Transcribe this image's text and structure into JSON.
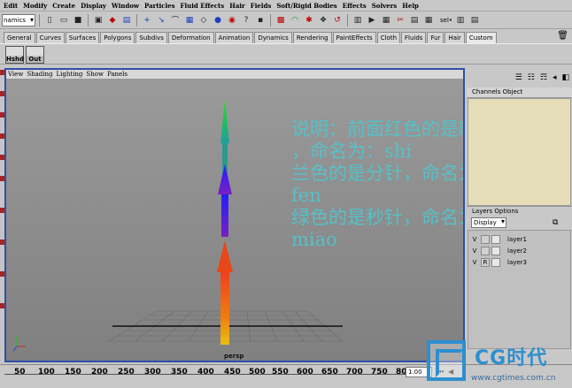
{
  "menu": [
    "Edit",
    "Modify",
    "Create",
    "Display",
    "Window",
    "Particles",
    "Fluid Effects",
    "Hair",
    "Fields",
    "Soft/Rigid Bodies",
    "Effects",
    "Solvers",
    "Help"
  ],
  "status_line": {
    "mode": "namics",
    "sel_field": "sel•"
  },
  "shelf_tabs": [
    "General",
    "Curves",
    "Surfaces",
    "Polygons",
    "Subdivs",
    "Deformation",
    "Animation",
    "Dynamics",
    "Rendering",
    "PaintEffects",
    "Cloth",
    "Fluids",
    "Fur",
    "Hair",
    "Custom"
  ],
  "shelf_buttons": [
    "Hshd",
    "Out"
  ],
  "panel_menu": [
    "View",
    "Shading",
    "Lighting",
    "Show",
    "Panels"
  ],
  "viewport": {
    "camera": "persp",
    "note_lines": [
      "说明：前面红色的是时针",
      "，命名为：shi",
      "兰色的是分针，命名为",
      "fen",
      "绿色的是秒针，命名为",
      "miao"
    ],
    "colors": {
      "hour_hand": "#e03a10",
      "minute_hand": "#1e1ee0",
      "second_hand": "#22d022",
      "note_text": "#56c0c8",
      "background": "#8a8a8a"
    }
  },
  "channel_box": {
    "header": "Channels Object"
  },
  "layers": {
    "header": "Layers Options",
    "display": "Display",
    "items": [
      {
        "vis": "V",
        "type": "",
        "name": "layer1"
      },
      {
        "vis": "V",
        "type": "",
        "name": "layer2"
      },
      {
        "vis": "V",
        "type": "R",
        "name": "layer3"
      }
    ]
  },
  "timeline": {
    "ticks": [
      "50",
      "100",
      "150",
      "200",
      "250",
      "300",
      "350",
      "400",
      "450",
      "500",
      "550",
      "600",
      "650",
      "700",
      "750",
      "800"
    ],
    "current_field": "1.00"
  },
  "watermark": {
    "brand": "CG时代",
    "url": "www.cgtimes.com.cn"
  }
}
